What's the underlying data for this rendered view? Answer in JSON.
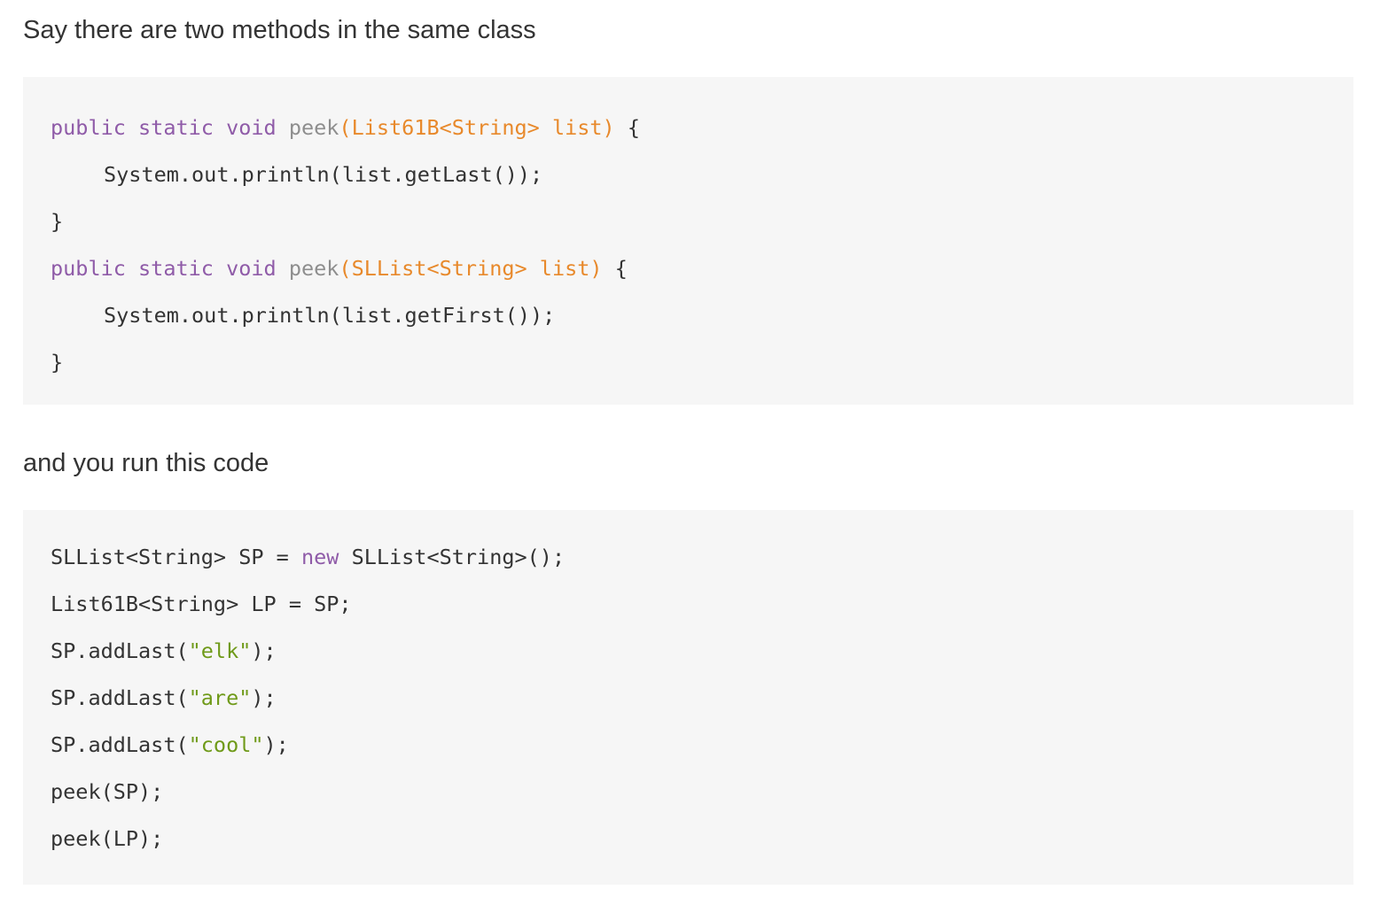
{
  "intro_text": "Say there are two methods in the same class",
  "methods_code": {
    "line1": {
      "kw": "public static void",
      "fn": "peek",
      "param": "(List61B<String> list)",
      "brace": " {"
    },
    "line2": "System.out.println(list.getLast());",
    "line3": "}",
    "line4": {
      "kw": "public static void",
      "fn": "peek",
      "param": "(SLList<String> list)",
      "brace": " {"
    },
    "line5": "System.out.println(list.getFirst());",
    "line6": "}"
  },
  "run_text": "and you run this code",
  "run_code": {
    "line1": {
      "pre": "SLList<String> SP = ",
      "kw": "new",
      "post": " SLList<String>();"
    },
    "line2": "List61B<String> LP = SP;",
    "line3": {
      "pre": "SP.addLast(",
      "str": "\"elk\"",
      "post": ");"
    },
    "line4": {
      "pre": "SP.addLast(",
      "str": "\"are\"",
      "post": ");"
    },
    "line5": {
      "pre": "SP.addLast(",
      "str": "\"cool\"",
      "post": ");"
    },
    "line6": "peek(SP);",
    "line7": "peek(LP);"
  },
  "colors": {
    "keyword": "#8f5ba8",
    "function": "#8e8e8e",
    "parameter": "#e8892b",
    "string": "#6f9a19",
    "text": "#333333",
    "code_background": "#f6f6f6"
  }
}
